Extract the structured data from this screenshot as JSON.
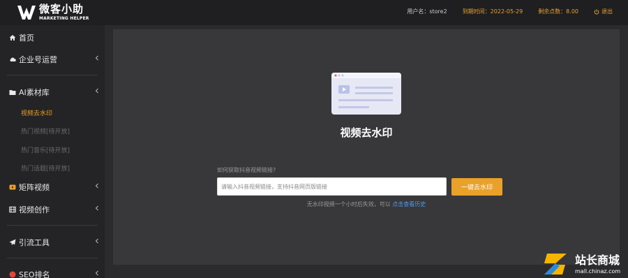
{
  "brand": {
    "title": "微客小助",
    "subtitle": "MARKETING HELPER",
    "accent": "#e9a12a"
  },
  "header": {
    "user": "用户名：store2",
    "expire": "到期时间：2022-05-29",
    "points": "剩余点数：8.00",
    "logout": "退出"
  },
  "sidebar": {
    "home": "首页",
    "enterprise": "企业号运营",
    "ai": "AI素材库",
    "ai_sub": [
      "视频去水印",
      "热门视频[待开放]",
      "热门音乐[待开放]",
      "热门话题[待开放]"
    ],
    "matrix": "矩阵视频",
    "creation": "视频创作",
    "traffic": "引流工具",
    "seo": "SEO排名"
  },
  "main": {
    "title": "视频去水印",
    "help": "如何获取抖音视频链接?",
    "input_placeholder": "请输入抖音视频链接，支持抖音网页版链接",
    "button": "一键去水印",
    "note": "无水印视频一个小时后失效，可以",
    "note_link": "点击查看历史"
  },
  "watermark": {
    "title": "站长商城",
    "url": "mall.chinaz.com"
  }
}
